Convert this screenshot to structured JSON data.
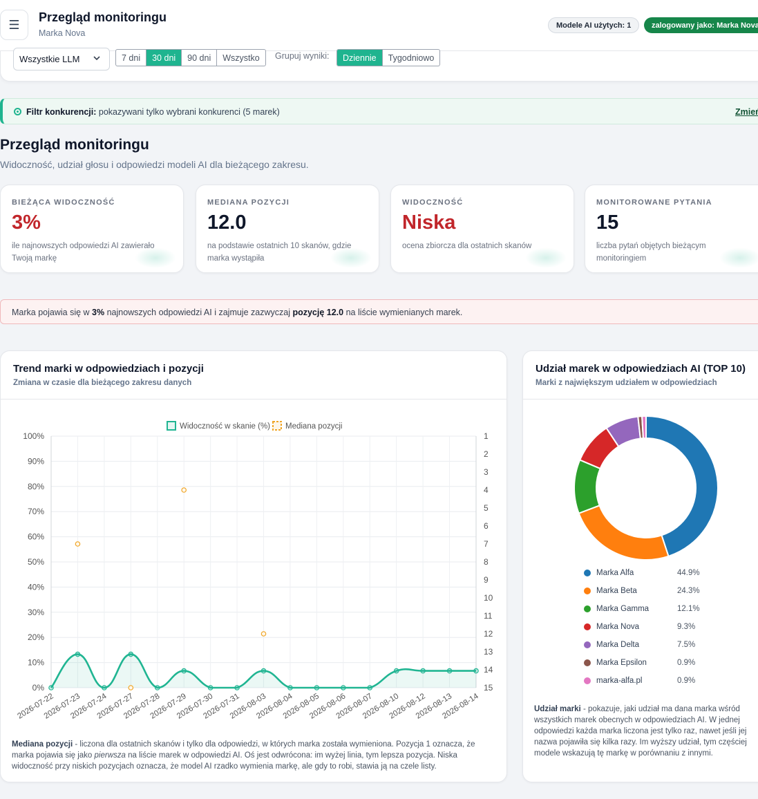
{
  "topbar": {
    "menu_glyph": "☰",
    "title": "Przegląd monitoringu",
    "subtitle": "Marka Nova",
    "models_badge": "Modele AI użytych: 1",
    "user_badge": "zalogowany jako: Marka Nova"
  },
  "filters": {
    "llm_select": "Wszystkie LLM",
    "ranges": [
      "7 dni",
      "30 dni",
      "90 dni",
      "Wszystko"
    ],
    "active_range": "30 dni",
    "group_label": "Grupuj wyniki:",
    "grouping": [
      "Dziennie",
      "Tygodniowo"
    ],
    "active_grouping": "Dziennie"
  },
  "competition": {
    "label": "Filtr konkurencji:",
    "text": "pokazywani tylko wybrani konkurenci (5 marek)",
    "link": "Zmień"
  },
  "page": {
    "title": "Przegląd monitoringu",
    "subtitle": "Widoczność, udział głosu i odpowiedzi modeli AI dla bieżącego zakresu."
  },
  "kpis": [
    {
      "label": "BIEŻĄCA WIDOCZNOŚĆ",
      "value": "3%",
      "desc": "ile najnowszych odpowiedzi AI zawierało Twoją markę"
    },
    {
      "label": "MEDIANA POZYCJI",
      "value": "12.0",
      "desc": "na podstawie ostatnich 10 skanów, gdzie marka wystąpiła"
    },
    {
      "label": "WIDOCZNOŚĆ",
      "value": "Niska",
      "desc": "ocena zbiorcza dla ostatnich skanów"
    },
    {
      "label": "MONITOROWANE PYTANIA",
      "value": "15",
      "desc": "liczba pytań objętych bieżącym monitoringiem"
    }
  ],
  "alert": {
    "pre": "Marka pojawia się w ",
    "pct": "3%",
    "mid": " najnowszych odpowiedzi AI i zajmuje zazwyczaj ",
    "pos": "pozycję 12.0",
    "post": " na liście wymienianych marek."
  },
  "trend_card": {
    "title": "Trend marki w odpowiedziach i pozycji",
    "subtitle": "Zmiana w czasie dla bieżącego zakresu danych",
    "note_bold": "Mediana pozycji",
    "note_1": " - liczona dla ostatnich skanów i tylko dla odpowiedzi, w których marka została wymieniona. Pozycja 1 oznacza, że marka pojawia się jako ",
    "note_italic": "pierwsza",
    "note_2": " na liście marek w odpowiedzi AI. Oś jest odwrócona: im wyżej linia, tym lepsza pozycja. Niska widoczność przy niskich pozycjach oznacza, że model AI rzadko wymienia markę, ale gdy to robi, stawia ją na czele listy."
  },
  "share_card": {
    "title": "Udział marek w odpowiedziach AI (TOP 10)",
    "subtitle": "Marki z największym udziałem w odpowiedziach",
    "note_bold": "Udział marki",
    "note": " - pokazuje, jaki udział ma dana marka wśród wszystkich marek obecnych w odpowiedziach AI. W jednej odpowiedzi każda marka liczona jest tylko raz, nawet jeśli jej nazwa pojawiła się kilka razy. Im wyższy udział, tym częściej modele wskazują tę markę w porównaniu z innymi."
  },
  "chart_data": [
    {
      "type": "line",
      "legend": [
        "Widoczność w skanie (%)",
        "Mediana pozycji"
      ],
      "x": [
        "2026-07-22",
        "2026-07-23",
        "2026-07-24",
        "2026-07-27",
        "2026-07-28",
        "2026-07-29",
        "2026-07-30",
        "2026-07-31",
        "2026-08-03",
        "2026-08-04",
        "2026-08-05",
        "2026-08-06",
        "2026-08-07",
        "2026-08-10",
        "2026-08-12",
        "2026-08-13",
        "2026-08-14"
      ],
      "series": [
        {
          "name": "Widoczność w skanie (%)",
          "axis": "left",
          "color": "#20b592",
          "values": [
            0,
            13.3,
            0,
            13.3,
            0,
            6.7,
            0,
            0,
            6.7,
            0,
            0,
            0,
            0,
            6.7,
            6.7,
            6.7,
            6.7
          ]
        },
        {
          "name": "Mediana pozycji",
          "axis": "right",
          "color": "#f0a525",
          "values": [
            null,
            7,
            null,
            15,
            null,
            4,
            null,
            null,
            12,
            null,
            null,
            null,
            null,
            null,
            null,
            null,
            null
          ]
        }
      ],
      "y_left": {
        "ticks": [
          "0%",
          "10%",
          "20%",
          "30%",
          "40%",
          "50%",
          "60%",
          "70%",
          "80%",
          "90%",
          "100%"
        ],
        "range": [
          0,
          100
        ]
      },
      "y_right": {
        "ticks": [
          "1",
          "2",
          "3",
          "4",
          "5",
          "6",
          "7",
          "8",
          "9",
          "10",
          "11",
          "12",
          "13",
          "14",
          "15"
        ],
        "range": [
          1,
          15
        ],
        "reversed": true
      },
      "grid": true,
      "legend_position": "top"
    },
    {
      "type": "pie",
      "donut": true,
      "labels": [
        "Marka Alfa",
        "Marka Beta",
        "Marka Gamma",
        "Marka Nova",
        "Marka Delta",
        "Marka Epsilon",
        "marka-alfa.pl"
      ],
      "values": [
        44.9,
        24.3,
        12.1,
        9.3,
        7.5,
        0.9,
        0.9
      ],
      "value_labels": [
        "44.9%",
        "24.3%",
        "12.1%",
        "9.3%",
        "7.5%",
        "0.9%",
        "0.9%"
      ],
      "colors": [
        "#1f77b4",
        "#ff7f0e",
        "#2ca02c",
        "#d62728",
        "#9467bd",
        "#8c564b",
        "#e377c2"
      ],
      "legend_position": "bottom"
    }
  ]
}
